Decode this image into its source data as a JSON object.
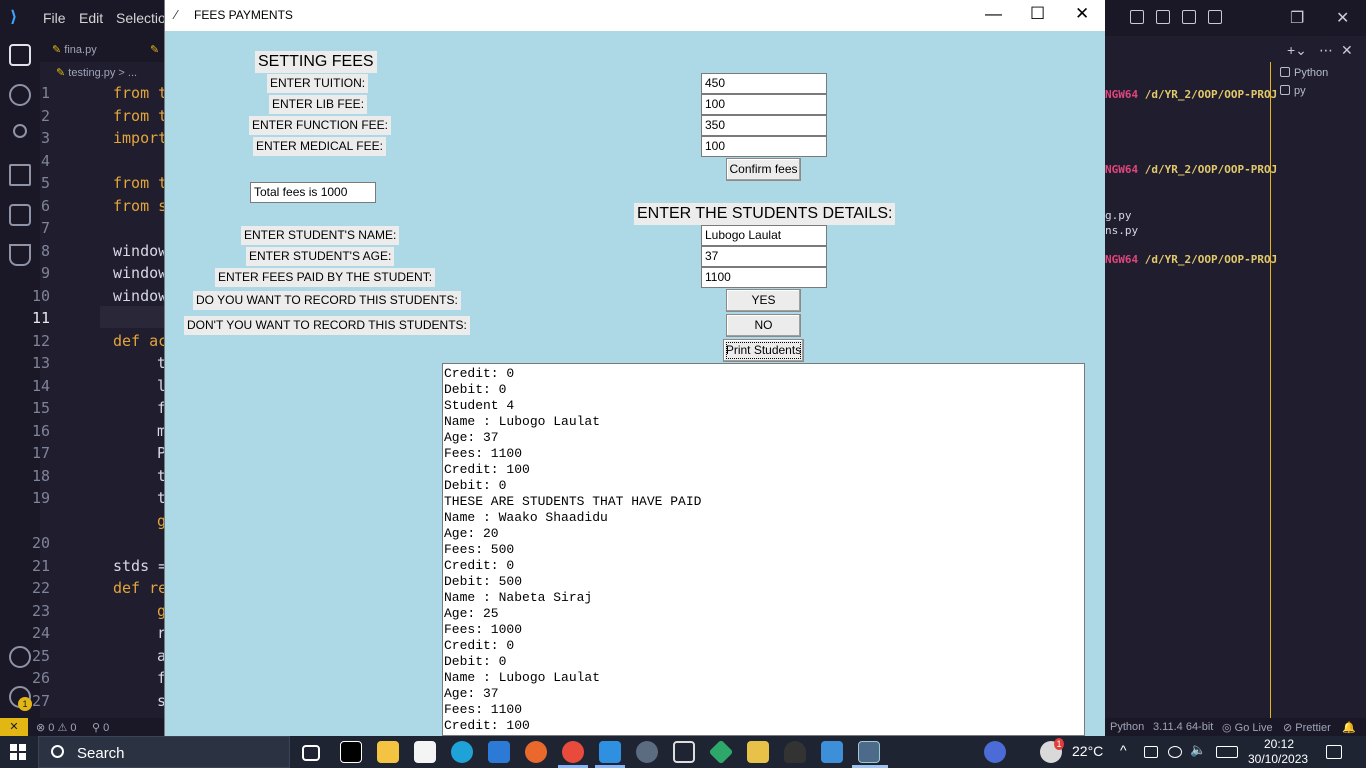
{
  "vscode": {
    "menu": [
      "File",
      "Edit",
      "Selectio"
    ],
    "tabs": [
      "fina.py",
      "testing.py"
    ],
    "breadcrumb": "testing.py > ...",
    "line_numbers": [
      "1",
      "2",
      "3",
      "4",
      "5",
      "6",
      "7",
      "8",
      "9",
      "10",
      "11",
      "12",
      "13",
      "14",
      "15",
      "16",
      "17",
      "18",
      "19",
      "20",
      "21",
      "22",
      "23",
      "24",
      "25",
      "26",
      "27"
    ],
    "code_lines": [
      "from t",
      "from t",
      "import",
      "",
      "from t",
      "from s",
      "",
      "window",
      "window",
      "window",
      "",
      "def ac",
      "t",
      "l",
      "f",
      "m",
      "P",
      "t",
      "t",
      "g",
      "",
      "stds =",
      "def re",
      "g",
      "r",
      "a",
      "f",
      "s"
    ],
    "right_panel": {
      "terminal_lines": [
        {
          "prefix": "NGW64",
          "path": "/d/YR_2/OOP/OOP-PROJ"
        },
        {
          "prefix": "NGW64",
          "path": "/d/YR_2/OOP/OOP-PROJ"
        },
        {
          "prefix": "NGW64",
          "path": "/d/YR_2/OOP/OOP-PROJ"
        }
      ],
      "file_lines": [
        "g.py",
        "ns.py"
      ],
      "terminal_list": [
        "Python",
        "py"
      ]
    },
    "status": {
      "remote": "✕",
      "errors": "0",
      "warnings": "0",
      "ports": "0",
      "language": "Python",
      "version": "3.11.4 64-bit",
      "golive": "Go Live",
      "prettier": "Prettier",
      "settings_badge": "1"
    }
  },
  "tk": {
    "title": "FEES PAYMENTS",
    "setting_heading": "SETTING FEES",
    "labels": {
      "tuition": "ENTER TUITION:",
      "lib": "ENTER LIB FEE:",
      "function": "ENTER FUNCTION FEE:",
      "medical": "ENTER MEDICAL FEE:",
      "student_name": "ENTER STUDENT'S NAME:",
      "student_age": "ENTER STUDENT'S AGE:",
      "fees_paid": "ENTER FEES PAID BY THE STUDENT:",
      "record_yes": "DO YOU WANT TO RECORD THIS STUDENTS:",
      "record_no": "DON'T YOU WANT TO RECORD THIS STUDENTS:"
    },
    "entries": {
      "tuition": "450",
      "lib": "100",
      "function": "350",
      "medical": "100",
      "student_name": "Lubogo Laulat",
      "student_age": "37",
      "fees_paid": "1100"
    },
    "total_fees": "Total fees is 1000",
    "details_heading": "ENTER THE STUDENTS DETAILS:",
    "buttons": {
      "confirm": "Confirm fees",
      "yes": "YES",
      "no": "NO",
      "print": "Print Students"
    },
    "output_lines": [
      "Credit: 0",
      "Debit: 0",
      "Student 4",
      "Name : Lubogo Laulat",
      "Age: 37",
      "Fees: 1100",
      "Credit: 100",
      "Debit: 0",
      "THESE ARE STUDENTS THAT HAVE PAID",
      "Name : Waako Shaadidu",
      "Age: 20",
      "Fees: 500",
      "Credit: 0",
      "Debit: 500",
      "Name : Nabeta Siraj",
      "Age: 25",
      "Fees: 1000",
      "Credit: 0",
      "Debit: 0",
      "Name : Lubogo Laulat",
      "Age: 37",
      "Fees: 1100",
      "Credit: 100"
    ]
  },
  "taskbar": {
    "search": "Search",
    "weather_temp": "22°C",
    "time": "20:12",
    "date": "30/10/2023",
    "weather_badge": "1"
  }
}
